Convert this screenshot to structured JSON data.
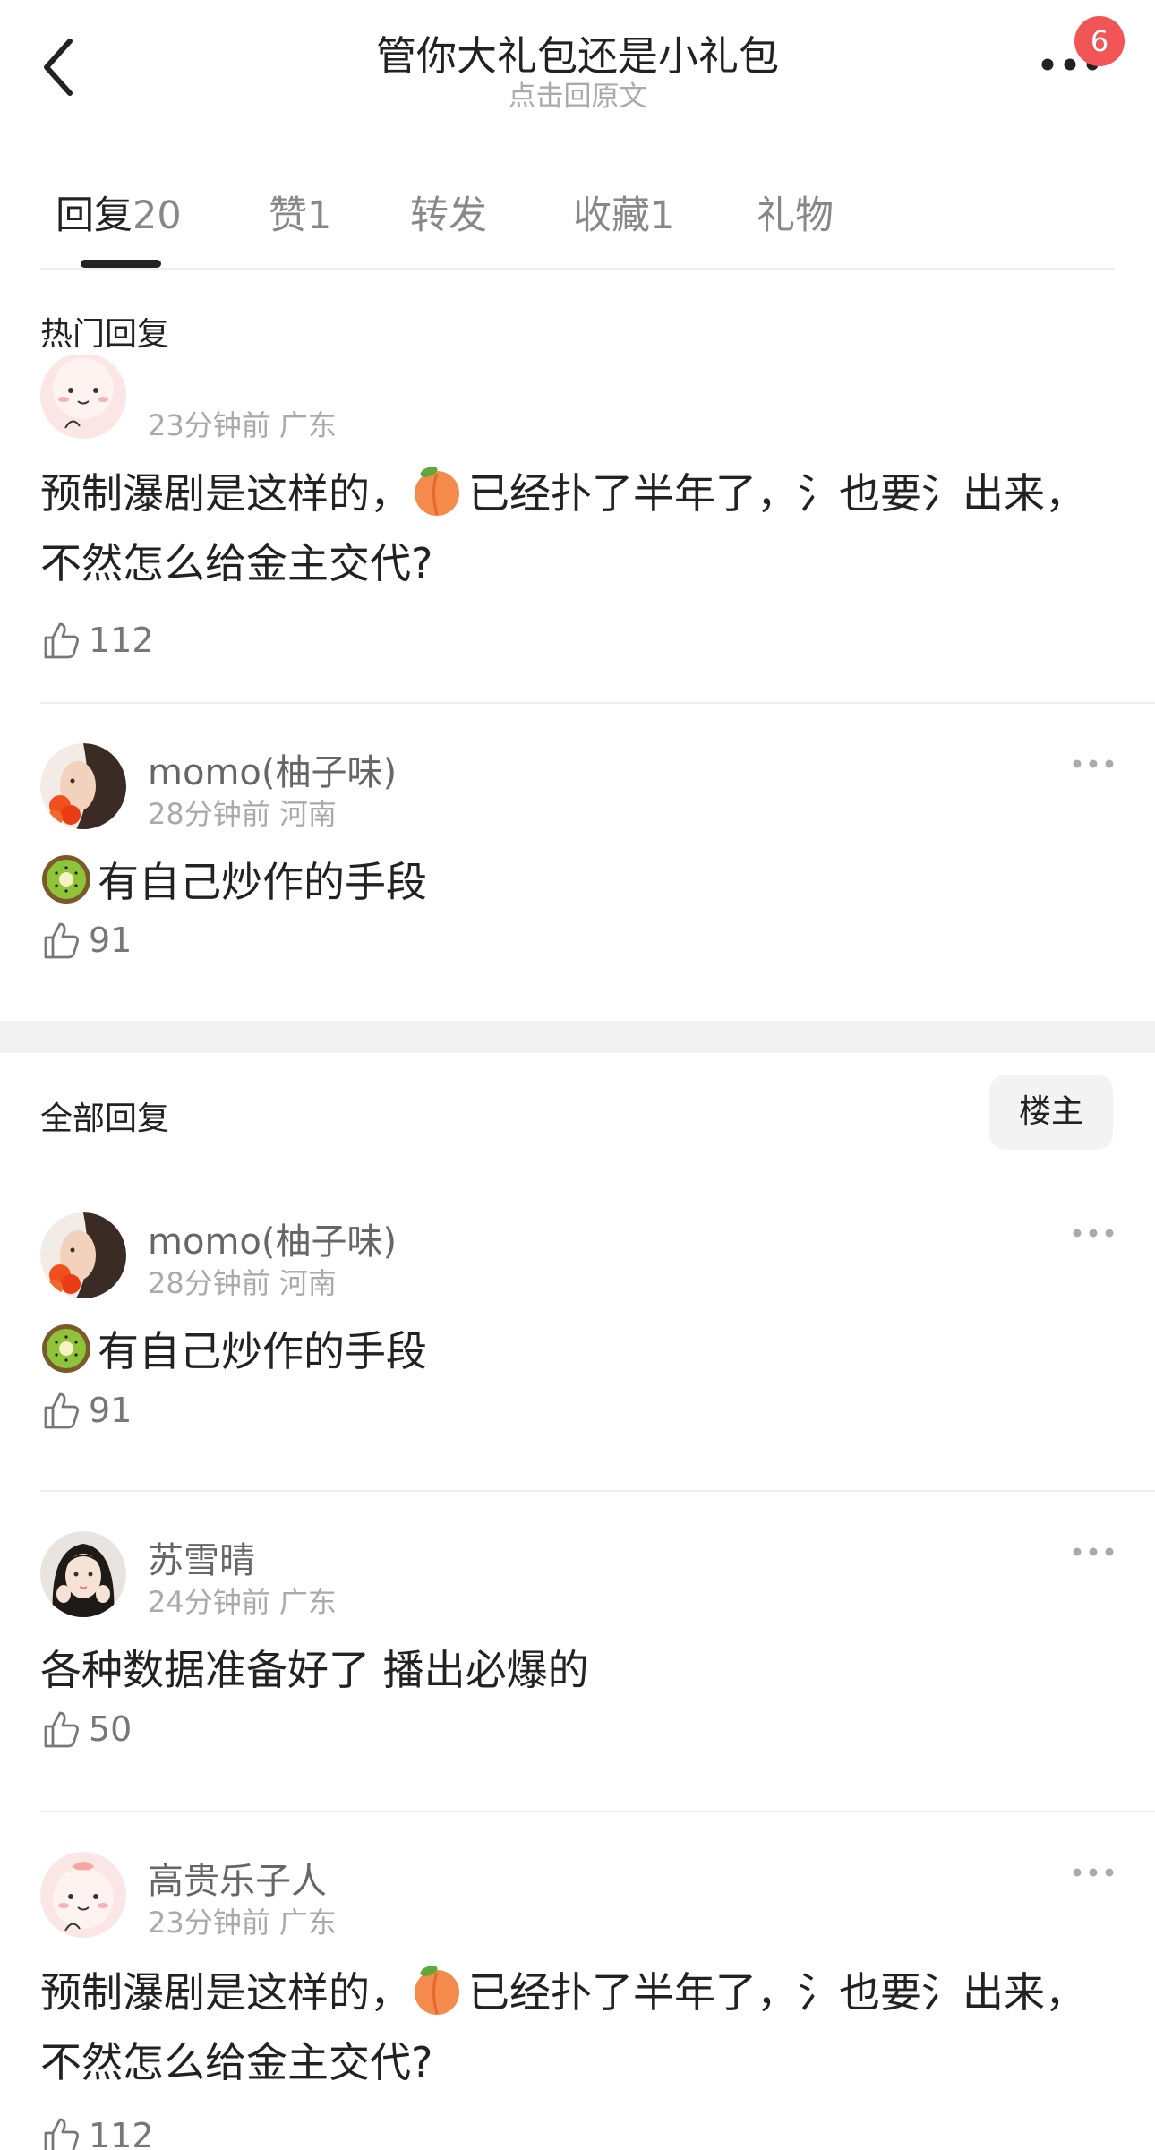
{
  "header": {
    "title": "管你大礼包还是小礼包",
    "subtitle": "点击回原文",
    "badge_count": "6",
    "back_icon": "chevron-left-icon",
    "more_icon": "more-horizontal-icon"
  },
  "tabs": [
    {
      "label": "回复",
      "count": "20",
      "active": true
    },
    {
      "label": "赞",
      "count": "1",
      "active": false
    },
    {
      "label": "转发",
      "count": "",
      "active": false
    },
    {
      "label": "收藏",
      "count": "1",
      "active": false
    },
    {
      "label": "礼物",
      "count": "",
      "active": false
    }
  ],
  "hot": {
    "title": "热门回复",
    "comments": [
      {
        "name": "",
        "time": "23分钟前",
        "location": "广东",
        "emoji": "peach",
        "text_before": "预制瀑剧是这样的，",
        "text_after": "已经扑了半年了，氵也要氵出来，不然怎么给金主交代?",
        "likes": "112"
      },
      {
        "name": "momo(柚子味)",
        "time": "28分钟前",
        "location": "河南",
        "emoji": "kiwi",
        "text_before": "",
        "text_after": "有自己炒作的手段",
        "likes": "91"
      }
    ]
  },
  "all": {
    "title": "全部回复",
    "owner_button": "楼主",
    "comments": [
      {
        "name": "momo(柚子味)",
        "time": "28分钟前",
        "location": "河南",
        "emoji": "kiwi",
        "text_before": "",
        "text_after": "有自己炒作的手段",
        "likes": "91"
      },
      {
        "name": "苏雪晴",
        "time": "24分钟前",
        "location": "广东",
        "emoji": "",
        "text_before": "",
        "text_after": "各种数据准备好了 播出必爆的",
        "likes": "50"
      },
      {
        "name": "高贵乐子人",
        "time": "23分钟前",
        "location": "广东",
        "emoji": "peach",
        "text_before": "预制瀑剧是这样的，",
        "text_after": "已经扑了半年了，氵也要氵出来，不然怎么给金主交代?",
        "likes": "112"
      }
    ]
  },
  "colors": {
    "badge": "#f25555",
    "muted": "#aaaaaa",
    "text": "#222222"
  }
}
